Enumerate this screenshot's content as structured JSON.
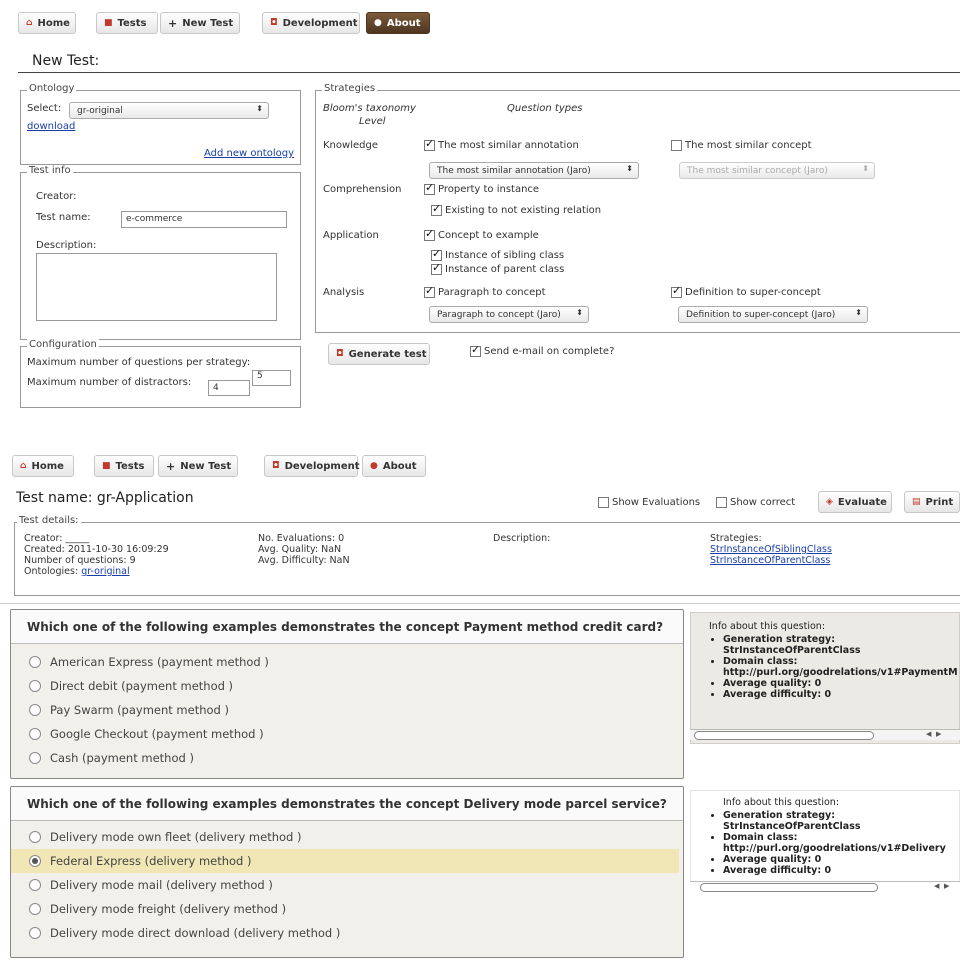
{
  "nav": {
    "home": "Home",
    "tests": "Tests",
    "new_test": "New Test",
    "development": "Development",
    "about": "About"
  },
  "top": {
    "title": "New Test:",
    "ontology": {
      "legend": "Ontology",
      "select_label": "Select:",
      "selected": "gr-original",
      "download": "download",
      "add_new": "Add new ontology"
    },
    "test_info": {
      "legend": "Test info",
      "creator": "Creator:",
      "test_name_label": "Test name:",
      "test_name_value": "e-commerce",
      "description": "Description:"
    },
    "configuration": {
      "legend": "Configuration",
      "max_questions": "Maximum number of questions per strategy:",
      "max_questions_value": "5",
      "max_distractors": "Maximum number of distractors:",
      "max_distractors_value": "4"
    },
    "strategies": {
      "legend": "Strategies",
      "bloom_header_1": "Bloom's taxonomy",
      "bloom_header_2": "Level",
      "question_types": "Question types",
      "knowledge": "Knowledge",
      "most_similar_annotation": "The most similar annotation",
      "most_similar_annotation_select": "The most similar annotation (Jaro)",
      "most_similar_concept": "The most similar concept",
      "most_similar_concept_select": "The most similar concept (Jaro)",
      "comprehension": "Comprehension",
      "property_to_instance": "Property to instance",
      "existing_to_not_existing": "Existing to not existing relation",
      "application": "Application",
      "concept_to_example": "Concept to example",
      "instance_of_sibling": "Instance of sibling class",
      "instance_of_parent": "Instance of parent class",
      "analysis": "Analysis",
      "paragraph_to_concept": "Paragraph to concept",
      "paragraph_to_concept_select": "Paragraph to concept (Jaro)",
      "definition_to_super": "Definition to super-concept",
      "definition_to_super_select": "Definition to super-concept (Jaro)"
    },
    "generate": "Generate test",
    "send_email": "Send e-mail on complete?"
  },
  "bottom": {
    "title": "Test name: gr-Application",
    "show_evaluations": "Show Evaluations",
    "show_correct": "Show correct",
    "evaluate": "Evaluate",
    "print": "Print",
    "details": {
      "legend": "Test details:",
      "creator": "Creator: _____",
      "created": "Created: 2011-10-30 16:09:29",
      "num_questions": "Number of questions: 9",
      "ontologies_label": "Ontologies:",
      "ontologies_link": "gr-original",
      "no_evaluations": "No. Evaluations: 0",
      "avg_quality": "Avg. Quality: NaN",
      "avg_difficulty": "Avg. Difficulty: NaN",
      "description": "Description:",
      "strategies_label": "Strategies:",
      "strategy_1": "StrInstanceOfSiblingClass",
      "strategy_2": "StrInstanceOfParentClass"
    },
    "questions": [
      {
        "title": "Which one of the following examples demonstrates the concept Payment method credit card?",
        "answers": [
          "American Express (payment method )",
          "Direct debit (payment method )",
          "Pay Swarm (payment method )",
          "Google Checkout (payment method )",
          "Cash (payment method )"
        ],
        "info": {
          "heading": "Info about this question:",
          "generation_label": "Generation strategy:",
          "generation_value": "StrInstanceOfParentClass",
          "domain_label": "Domain class:",
          "domain_value": "http://purl.org/goodrelations/v1#PaymentM",
          "avg_quality": "Average quality: 0",
          "avg_difficulty": "Average difficulty: 0"
        }
      },
      {
        "title": "Which one of the following examples demonstrates the concept Delivery mode parcel service?",
        "answers": [
          "Delivery mode own fleet (delivery method )",
          "Federal Express (delivery method )",
          "Delivery mode mail (delivery method )",
          "Delivery mode freight (delivery method )",
          "Delivery mode direct download (delivery method )"
        ],
        "selected_index": 1,
        "info": {
          "heading": "Info about this question:",
          "generation_label": "Generation strategy:",
          "generation_value": "StrInstanceOfParentClass",
          "domain_label": "Domain class:",
          "domain_value": "http://purl.org/goodrelations/v1#Delivery",
          "avg_quality": "Average quality: 0",
          "avg_difficulty": "Average difficulty: 0"
        }
      }
    ]
  }
}
